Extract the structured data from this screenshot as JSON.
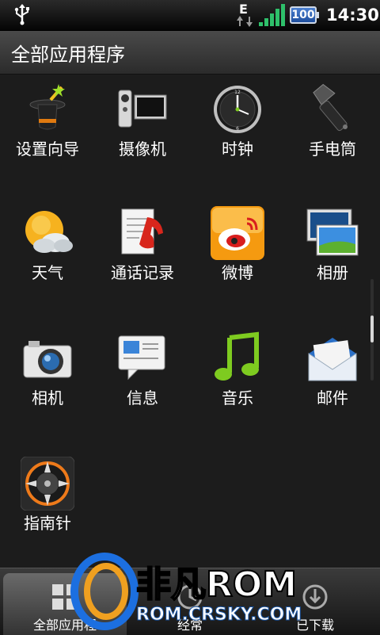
{
  "status_bar": {
    "network_type": "E",
    "battery_level": "100",
    "time": "14:30",
    "icons": [
      "usb-icon",
      "network-edge-icon",
      "signal-icon",
      "battery-icon"
    ]
  },
  "header": {
    "title": "全部应用程序"
  },
  "apps": [
    {
      "label": "设置向导",
      "icon": "wizard-hat-icon"
    },
    {
      "label": "摄像机",
      "icon": "camcorder-icon"
    },
    {
      "label": "时钟",
      "icon": "clock-icon"
    },
    {
      "label": "手电筒",
      "icon": "flashlight-icon"
    },
    {
      "label": "天气",
      "icon": "weather-icon"
    },
    {
      "label": "通话记录",
      "icon": "call-log-icon"
    },
    {
      "label": "微博",
      "icon": "weibo-icon"
    },
    {
      "label": "相册",
      "icon": "gallery-icon"
    },
    {
      "label": "相机",
      "icon": "camera-icon"
    },
    {
      "label": "信息",
      "icon": "messages-icon"
    },
    {
      "label": "音乐",
      "icon": "music-icon"
    },
    {
      "label": "邮件",
      "icon": "mail-icon"
    },
    {
      "label": "指南针",
      "icon": "compass-icon"
    }
  ],
  "tabs": [
    {
      "label": "全部应用程",
      "selected": true,
      "icon": "grid-icon"
    },
    {
      "label": "经常",
      "selected": false,
      "icon": "frequent-icon"
    },
    {
      "label": "已下载",
      "selected": false,
      "icon": "download-icon"
    }
  ],
  "watermark": {
    "brand": "非凡ROM",
    "url": "ROM.CRSKY.COM"
  },
  "colors": {
    "background": "#1c1c1c",
    "accent_green": "#7ecb20",
    "weibo_orange": "#f39c12"
  }
}
